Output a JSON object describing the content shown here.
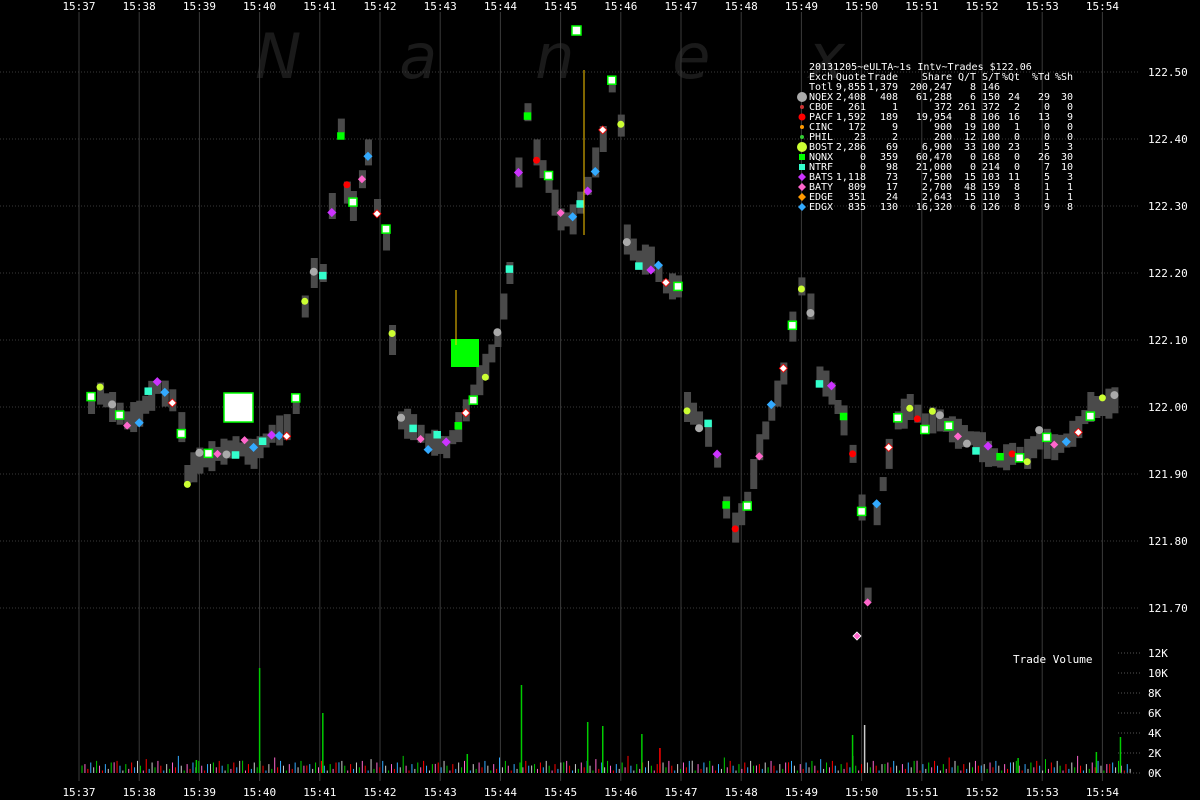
{
  "chart_data": {
    "type": "scatter",
    "watermark": "Nanex",
    "title": "20131205~eULTA~1s Intv~Trades $122.06",
    "x_ticks": [
      "15:37",
      "15:38",
      "15:39",
      "15:40",
      "15:41",
      "15:42",
      "15:43",
      "15:44",
      "15:45",
      "15:46",
      "15:47",
      "15:48",
      "15:49",
      "15:50",
      "15:51",
      "15:52",
      "15:53",
      "15:54"
    ],
    "y_ticks": [
      "122.50",
      "122.40",
      "122.30",
      "122.20",
      "122.10",
      "122.00",
      "121.90",
      "121.80",
      "121.70"
    ],
    "y_range": [
      121.637,
      122.56
    ],
    "volume_label": "Trade Volume",
    "volume_ticks": [
      "12K",
      "10K",
      "8K",
      "6K",
      "4K",
      "2K",
      "0K"
    ],
    "volume_range": [
      0,
      12000
    ],
    "legend_header": [
      "Exch",
      "Quote",
      "Trade",
      "Share",
      "Q/T",
      "S/T",
      "%Qt",
      "%Td",
      "%Sh"
    ],
    "legend_total": [
      "Totl",
      "9,855",
      "1,379",
      "200,247",
      "8",
      "146",
      "",
      "",
      ""
    ],
    "legend_rows": [
      {
        "color": "#aaaaaa",
        "shape": "circle-large",
        "cells": [
          "NQEX",
          "2,408",
          "408",
          "61,288",
          "6",
          "150",
          "24",
          "29",
          "30"
        ]
      },
      {
        "color": "#cc3333",
        "shape": "dot",
        "cells": [
          "CBOE",
          "261",
          "1",
          "372",
          "261",
          "372",
          "2",
          "0",
          "0"
        ]
      },
      {
        "color": "#ff0000",
        "shape": "circle",
        "cells": [
          "PACF",
          "1,592",
          "189",
          "19,954",
          "8",
          "106",
          "16",
          "13",
          "9"
        ]
      },
      {
        "color": "#ff9900",
        "shape": "dot",
        "cells": [
          "CINC",
          "172",
          "9",
          "900",
          "19",
          "100",
          "1",
          "0",
          "0"
        ]
      },
      {
        "color": "#33cc33",
        "shape": "dot",
        "cells": [
          "PHIL",
          "23",
          "2",
          "200",
          "12",
          "100",
          "0",
          "0",
          "0"
        ]
      },
      {
        "color": "#ccff33",
        "shape": "circle-large",
        "cells": [
          "BOST",
          "2,286",
          "69",
          "6,900",
          "33",
          "100",
          "23",
          "5",
          "3"
        ]
      },
      {
        "color": "#00ff00",
        "shape": "square",
        "cells": [
          "NQNX",
          "0",
          "359",
          "60,470",
          "0",
          "168",
          "0",
          "26",
          "30"
        ]
      },
      {
        "color": "#33ffcc",
        "shape": "square",
        "cells": [
          "NTRF",
          "0",
          "98",
          "21,000",
          "0",
          "214",
          "0",
          "7",
          "10"
        ]
      },
      {
        "color": "#cc33ff",
        "shape": "diamond",
        "cells": [
          "BATS",
          "1,118",
          "73",
          "7,500",
          "15",
          "103",
          "11",
          "5",
          "3"
        ]
      },
      {
        "color": "#ff66cc",
        "shape": "diamond",
        "cells": [
          "BATY",
          "809",
          "17",
          "2,700",
          "48",
          "159",
          "8",
          "1",
          "1"
        ]
      },
      {
        "color": "#ff9900",
        "shape": "diamond",
        "cells": [
          "EDGE",
          "351",
          "24",
          "2,643",
          "15",
          "110",
          "3",
          "1",
          "1"
        ]
      },
      {
        "color": "#33aaff",
        "shape": "diamond",
        "cells": [
          "EDGX",
          "835",
          "130",
          "16,320",
          "6",
          "126",
          "8",
          "9",
          "8"
        ]
      }
    ],
    "price_path": [
      [
        0.2,
        122.0
      ],
      [
        0.35,
        122.02
      ],
      [
        0.55,
        122.0
      ],
      [
        0.8,
        121.98
      ],
      [
        1.0,
        121.99
      ],
      [
        1.3,
        122.03
      ],
      [
        1.55,
        122.01
      ],
      [
        1.7,
        121.97
      ],
      [
        1.8,
        121.9
      ],
      [
        2.0,
        121.92
      ],
      [
        2.3,
        121.93
      ],
      [
        2.6,
        121.94
      ],
      [
        2.9,
        121.93
      ],
      [
        3.2,
        121.96
      ],
      [
        3.45,
        121.97
      ],
      [
        3.6,
        122.0
      ],
      [
        3.75,
        122.15
      ],
      [
        3.9,
        122.2
      ],
      [
        4.05,
        122.2
      ],
      [
        4.2,
        122.3
      ],
      [
        4.35,
        122.42
      ],
      [
        4.45,
        122.32
      ],
      [
        4.55,
        122.3
      ],
      [
        4.7,
        122.34
      ],
      [
        4.8,
        122.38
      ],
      [
        4.95,
        122.3
      ],
      [
        5.1,
        122.25
      ],
      [
        5.2,
        122.1
      ],
      [
        5.35,
        121.98
      ],
      [
        5.55,
        121.97
      ],
      [
        5.8,
        121.95
      ],
      [
        6.1,
        121.94
      ],
      [
        6.3,
        121.97
      ],
      [
        6.55,
        122.02
      ],
      [
        6.75,
        122.06
      ],
      [
        6.95,
        122.1
      ],
      [
        7.15,
        122.2
      ],
      [
        7.3,
        122.35
      ],
      [
        7.45,
        122.44
      ],
      [
        7.6,
        122.38
      ],
      [
        7.8,
        122.33
      ],
      [
        8.0,
        122.28
      ],
      [
        8.2,
        122.28
      ],
      [
        8.45,
        122.33
      ],
      [
        8.7,
        122.4
      ],
      [
        8.85,
        122.48
      ],
      [
        9.0,
        122.42
      ],
      [
        9.1,
        122.25
      ],
      [
        9.3,
        122.22
      ],
      [
        9.5,
        122.22
      ],
      [
        9.75,
        122.18
      ],
      [
        9.95,
        122.18
      ],
      [
        10.1,
        122.0
      ],
      [
        10.3,
        121.98
      ],
      [
        10.45,
        121.96
      ],
      [
        10.6,
        121.92
      ],
      [
        10.75,
        121.85
      ],
      [
        10.9,
        121.82
      ],
      [
        11.1,
        121.86
      ],
      [
        11.3,
        121.94
      ],
      [
        11.5,
        121.99
      ],
      [
        11.7,
        122.05
      ],
      [
        11.85,
        122.12
      ],
      [
        12.0,
        122.18
      ],
      [
        12.15,
        122.15
      ],
      [
        12.3,
        122.05
      ],
      [
        12.5,
        122.02
      ],
      [
        12.7,
        121.98
      ],
      [
        12.85,
        121.93
      ],
      [
        13.0,
        121.85
      ],
      [
        13.1,
        121.72
      ],
      [
        13.25,
        121.84
      ],
      [
        13.45,
        121.93
      ],
      [
        13.6,
        121.98
      ],
      [
        13.8,
        122.0
      ],
      [
        14.05,
        121.98
      ],
      [
        14.3,
        121.98
      ],
      [
        14.6,
        121.96
      ],
      [
        14.9,
        121.95
      ],
      [
        15.1,
        121.93
      ],
      [
        15.3,
        121.92
      ],
      [
        15.5,
        121.93
      ],
      [
        15.75,
        121.93
      ],
      [
        15.95,
        121.95
      ],
      [
        16.2,
        121.94
      ],
      [
        16.4,
        121.95
      ],
      [
        16.6,
        121.97
      ],
      [
        16.8,
        122.0
      ],
      [
        17.0,
        122.0
      ],
      [
        17.2,
        122.01
      ],
      [
        17.35,
        122.02
      ]
    ],
    "volume_spikes": [
      [
        3.0,
        10500,
        "#00cc00"
      ],
      [
        4.05,
        6000,
        "#00cc00"
      ],
      [
        7.35,
        8800,
        "#00cc00"
      ],
      [
        8.45,
        5100,
        "#00cc00"
      ],
      [
        8.7,
        4700,
        "#00cc00"
      ],
      [
        9.35,
        3900,
        "#00cc00"
      ],
      [
        9.65,
        2500,
        "#ff0000"
      ],
      [
        13.05,
        4800,
        "#cccccc"
      ],
      [
        12.85,
        3800,
        "#00cc00"
      ],
      [
        17.3,
        3600,
        "#00cc00"
      ],
      [
        16.9,
        2100,
        "#00cc00"
      ],
      [
        6.45,
        1900,
        "#00cc00"
      ],
      [
        1.95,
        1300,
        "#00cc00"
      ],
      [
        15.6,
        1500,
        "#00cc00"
      ]
    ]
  }
}
